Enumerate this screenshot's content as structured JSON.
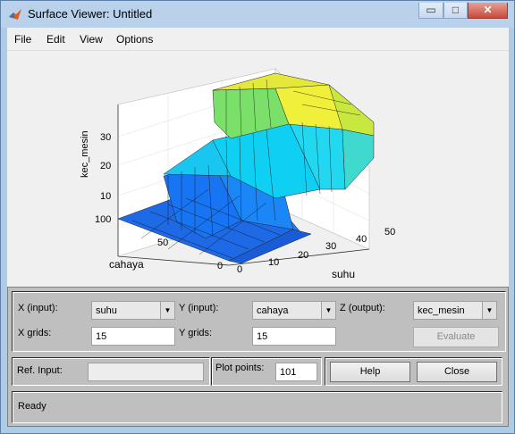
{
  "window": {
    "title": "Surface Viewer: Untitled"
  },
  "menu": [
    "File",
    "Edit",
    "View",
    "Options"
  ],
  "plot": {
    "zlabel": "kec_mesin",
    "ylabel": "cahaya",
    "xlabel": "suhu",
    "z_ticks": [
      "10",
      "20",
      "30"
    ],
    "y_ticks": [
      "0",
      "50",
      "100"
    ],
    "x_ticks": [
      "0",
      "10",
      "20",
      "30",
      "40",
      "50"
    ]
  },
  "chart_data": {
    "type": "surface",
    "x": {
      "label": "suhu",
      "range": [
        0,
        50
      ]
    },
    "y": {
      "label": "cahaya",
      "range": [
        0,
        100
      ]
    },
    "z": {
      "label": "kec_mesin",
      "range": [
        0,
        40
      ]
    },
    "grid": true
  },
  "controls": {
    "x_input_label": "X (input):",
    "x_input_value": "suhu",
    "y_input_label": "Y (input):",
    "y_input_value": "cahaya",
    "z_output_label": "Z (output):",
    "z_output_value": "kec_mesin",
    "x_grids_label": "X grids:",
    "x_grids_value": "15",
    "y_grids_label": "Y grids:",
    "y_grids_value": "15",
    "evaluate_label": "Evaluate",
    "ref_input_label": "Ref. Input:",
    "ref_input_value": "",
    "plot_points_label": "Plot points:",
    "plot_points_value": "101",
    "help_label": "Help",
    "close_label": "Close",
    "status": "Ready"
  },
  "titlebar_buttons": {
    "minimize": "▭",
    "maximize": "□",
    "close": "✕"
  }
}
